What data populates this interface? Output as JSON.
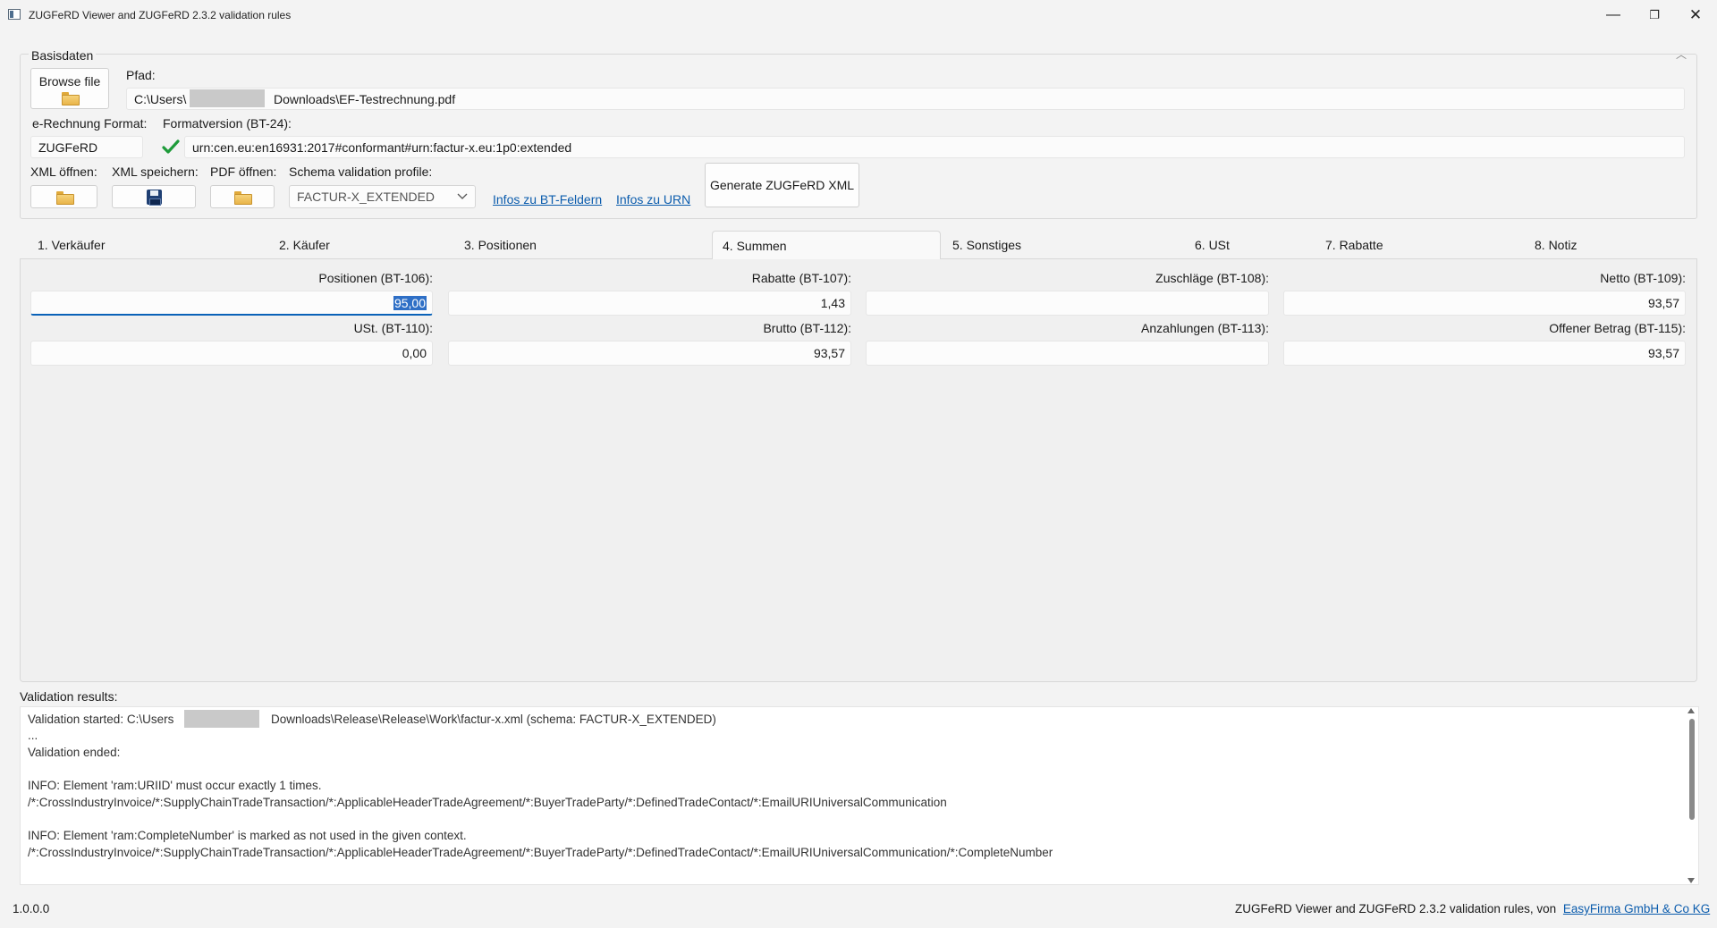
{
  "window": {
    "title": "ZUGFeRD Viewer and ZUGFeRD 2.3.2 validation rules",
    "minimize": "—",
    "maximize": "❐",
    "close": "✕"
  },
  "basisdaten": {
    "legend": "Basisdaten",
    "browse_label": "Browse file",
    "pfad_label": "Pfad:",
    "path_prefix": "C:\\Users\\",
    "path_suffix": "Downloads\\EF-Testrechnung.pdf",
    "format_label": "e-Rechnung Format:",
    "format_value": "ZUGFeRD",
    "formatversion_label": "Formatversion (BT-24):",
    "formatversion_value": "urn:cen.eu:en16931:2017#conformant#urn:factur-x.eu:1p0:extended",
    "xml_open_label": "XML öffnen:",
    "xml_save_label": "XML speichern:",
    "pdf_open_label": "PDF öffnen:",
    "schema_label": "Schema validation profile:",
    "schema_value": "FACTUR-X_EXTENDED",
    "link_bt": "Infos zu BT-Feldern",
    "link_urn": "Infos zu URN",
    "generate_label": "Generate ZUGFeRD XML"
  },
  "tabs": [
    {
      "label": "1. Verkäufer"
    },
    {
      "label": "2. Käufer"
    },
    {
      "label": "3. Positionen"
    },
    {
      "label": "4. Summen"
    },
    {
      "label": "5. Sonstiges"
    },
    {
      "label": "6. USt"
    },
    {
      "label": "7. Rabatte"
    },
    {
      "label": "8. Notiz"
    }
  ],
  "active_tab": "4. Summen",
  "summen": {
    "positionen": {
      "label": "Positionen (BT-106):",
      "value": "95,00"
    },
    "rabatte": {
      "label": "Rabatte (BT-107):",
      "value": "1,43"
    },
    "zuschlaege": {
      "label": "Zuschläge (BT-108):",
      "value": ""
    },
    "netto": {
      "label": "Netto (BT-109):",
      "value": "93,57"
    },
    "ust": {
      "label": "USt. (BT-110):",
      "value": "0,00"
    },
    "brutto": {
      "label": "Brutto (BT-112):",
      "value": "93,57"
    },
    "anzahlungen": {
      "label": "Anzahlungen (BT-113):",
      "value": ""
    },
    "offen": {
      "label": "Offener Betrag (BT-115):",
      "value": "93,57"
    }
  },
  "validation": {
    "label": "Validation results:",
    "line1_prefix": "Validation started: C:\\Users",
    "line1_suffix": "Downloads\\Release\\Release\\Work\\factur-x.xml (schema: FACTUR-X_EXTENDED)",
    "line2": "...",
    "line3": "Validation ended:",
    "line4": "INFO: Element 'ram:URIID' must occur exactly 1 times.",
    "line5": "/*:CrossIndustryInvoice/*:SupplyChainTradeTransaction/*:ApplicableHeaderTradeAgreement/*:BuyerTradeParty/*:DefinedTradeContact/*:EmailURIUniversalCommunication",
    "line6": "INFO: Element 'ram:CompleteNumber' is marked as not used in the given context.",
    "line7": "/*:CrossIndustryInvoice/*:SupplyChainTradeTransaction/*:ApplicableHeaderTradeAgreement/*:BuyerTradeParty/*:DefinedTradeContact/*:EmailURIUniversalCommunication/*:CompleteNumber"
  },
  "status": {
    "version": "1.0.0.0",
    "footer_prefix": "ZUGFeRD Viewer and ZUGFeRD 2.3.2 validation rules, von",
    "footer_link": "EasyFirma GmbH & Co KG"
  }
}
